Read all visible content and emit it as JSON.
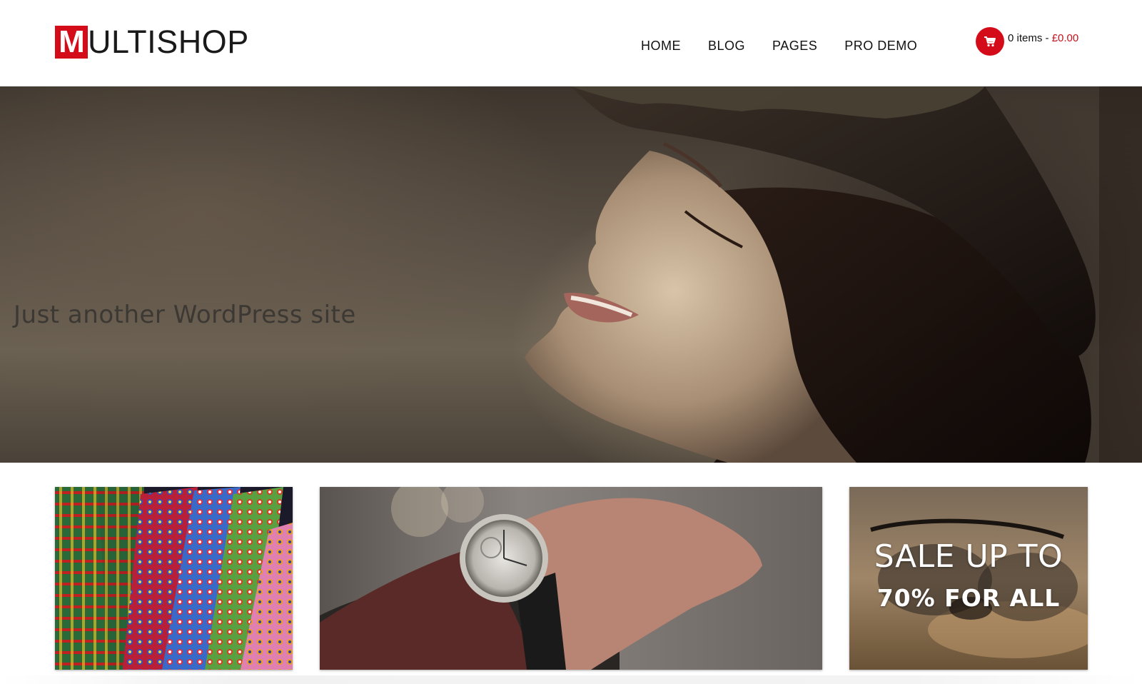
{
  "brand": {
    "logo_letter": "M",
    "logo_text": "ULTISHOP",
    "accent_color": "#d40c1a"
  },
  "nav": {
    "items": [
      {
        "label": "HOME"
      },
      {
        "label": "BLOG"
      },
      {
        "label": "PAGES"
      },
      {
        "label": "PRO DEMO"
      }
    ]
  },
  "cart": {
    "icon": "cart-icon",
    "count_label": "0 items",
    "separator": " - ",
    "total": "£0.00"
  },
  "hero": {
    "tagline": "Just another WordPress site"
  },
  "promos": {
    "sale": {
      "line1": "SALE UP TO",
      "line2": "70% FOR ALL"
    }
  }
}
